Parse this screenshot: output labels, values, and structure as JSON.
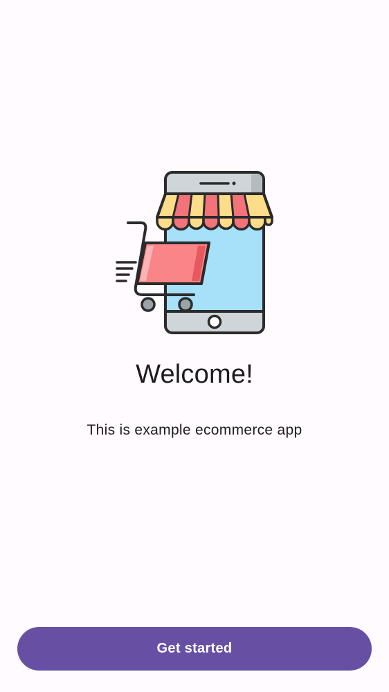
{
  "welcome": {
    "illustration": "shopping-cart-phone-store-illustration",
    "title": "Welcome!",
    "subtitle": "This is example ecommerce app",
    "get_started_label": "Get started"
  },
  "colors": {
    "background": "#fffbfe",
    "primary": "#6750a4",
    "on_primary": "#ffffff",
    "text": "#1d1b20",
    "phone_screen": "#a6e1f9",
    "awning_red": "#f3737b",
    "awning_yellow": "#fddc8a",
    "cart_red": "#f98589"
  }
}
